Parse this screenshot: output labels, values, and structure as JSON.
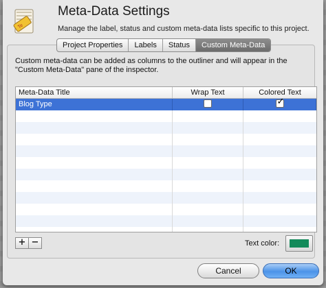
{
  "dialog": {
    "title": "Meta-Data Settings",
    "subtitle": "Manage the label, status and custom meta-data lists specific to this project."
  },
  "tabs": [
    {
      "label": "Project Properties",
      "active": false
    },
    {
      "label": "Labels",
      "active": false
    },
    {
      "label": "Status",
      "active": false
    },
    {
      "label": "Custom Meta-Data",
      "active": true
    }
  ],
  "description": "Custom meta-data can be added as columns to the outliner and will appear in the \"Custom Meta-Data\" pane of the inspector.",
  "table": {
    "columns": [
      "Meta-Data Title",
      "Wrap Text",
      "Colored Text"
    ],
    "rows": [
      {
        "title": "Blog Type",
        "wrap_text": false,
        "colored_text": true,
        "selected": true
      }
    ],
    "empty_row_count": 11
  },
  "add_label": "+",
  "remove_label": "−",
  "text_color": {
    "label": "Text color:",
    "value": "#138a5a"
  },
  "buttons": {
    "cancel": "Cancel",
    "ok": "OK"
  },
  "colors": {
    "selection": "#3d72d6",
    "ok_button": "#4b93e8"
  }
}
